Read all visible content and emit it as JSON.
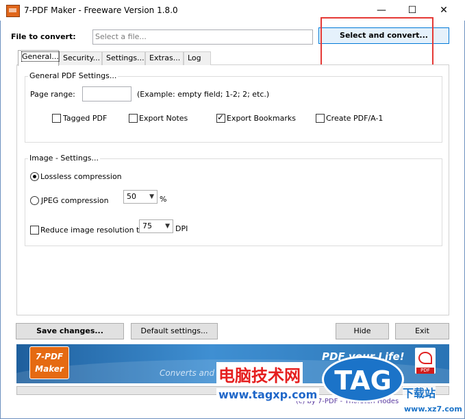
{
  "window": {
    "title": "7-PDF Maker - Freeware Version 1.8.0",
    "minimize": "—",
    "maximize": "☐",
    "close": "✕"
  },
  "file_row": {
    "label": "File to convert:",
    "placeholder": "Select a file...",
    "select_convert_label": "Select and convert..."
  },
  "tabs": [
    {
      "label": "General..."
    },
    {
      "label": "Security..."
    },
    {
      "label": "Settings..."
    },
    {
      "label": "Extras..."
    },
    {
      "label": "Log"
    }
  ],
  "general_pdf": {
    "group_title": "General PDF Settings...",
    "page_range_label": "Page range:",
    "page_range_value": "",
    "page_range_hint": "(Example: empty field; 1-2; 2; etc.)",
    "options": [
      {
        "label": "Tagged PDF",
        "checked": false
      },
      {
        "label": "Export Notes",
        "checked": false
      },
      {
        "label": "Export Bookmarks",
        "checked": true
      },
      {
        "label": "Create PDF/A-1",
        "checked": false
      }
    ]
  },
  "image_settings": {
    "group_title": "Image - Settings...",
    "lossless_label": "Lossless compression",
    "lossless_selected": true,
    "jpeg_label": "JPEG compression",
    "jpeg_selected": false,
    "jpeg_quality": "50",
    "jpeg_unit": "%",
    "reduce_label": "Reduce image resolution to",
    "reduce_checked": false,
    "dpi_value": "75",
    "dpi_unit": "DPI"
  },
  "actions": {
    "save": "Save changes...",
    "defaults": "Default settings...",
    "hide": "Hide",
    "exit": "Exit"
  },
  "banner": {
    "logo_line1": "7-PDF",
    "logo_line2": "Maker",
    "slogan": "PDF your Life!",
    "subslogan": "Converts and",
    "pdf_icon_label": "PDF"
  },
  "footer": {
    "credit": "(c) by 7-PDF - Thorsten Hodes"
  },
  "watermark": {
    "cn_text": "电脑技术网",
    "url": "www.tagxp.com",
    "tag": "TAG",
    "side_cn": "下载站",
    "side_url": "www.xz7.com"
  },
  "colors": {
    "accent_border": "#0078d7",
    "highlight_box": "#e53935",
    "banner_blue": "#2f7fc0",
    "logo_orange": "#e56a12"
  }
}
